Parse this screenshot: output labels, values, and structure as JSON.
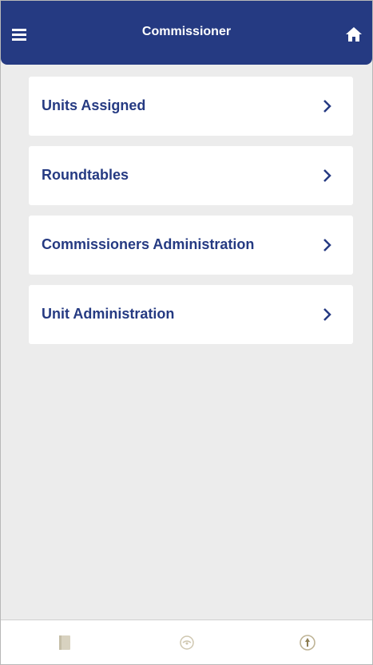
{
  "header": {
    "title": "Commissioner",
    "menu_icon": "hamburger-menu-icon",
    "home_icon": "home-icon",
    "background_color": "#253a82"
  },
  "menu": {
    "items": [
      {
        "label": "Units Assigned",
        "icon": "chevron-right-icon"
      },
      {
        "label": "Roundtables",
        "icon": "chevron-right-icon"
      },
      {
        "label": "Commissioners Administration",
        "icon": "chevron-right-icon"
      },
      {
        "label": "Unit Administration",
        "icon": "chevron-right-icon"
      }
    ],
    "label_color": "#253a82"
  },
  "bottom_nav": {
    "tabs": [
      {
        "icon": "book-icon"
      },
      {
        "icon": "badge-icon"
      },
      {
        "icon": "emblem-icon"
      }
    ],
    "icon_color": "#c9bfa3"
  }
}
